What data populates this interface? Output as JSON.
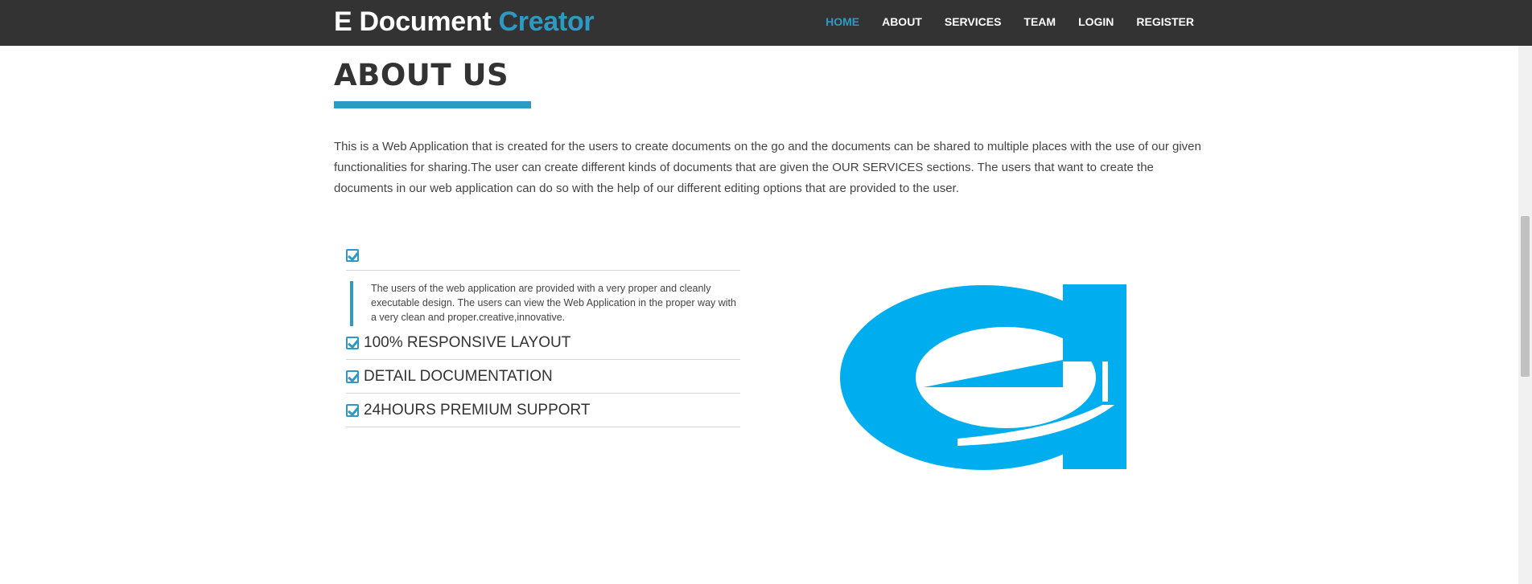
{
  "header": {
    "brand_main": "E Document ",
    "brand_accent": "Creator",
    "nav": [
      {
        "label": "HOME",
        "active": true
      },
      {
        "label": "ABOUT",
        "active": false
      },
      {
        "label": "SERVICES",
        "active": false
      },
      {
        "label": "TEAM",
        "active": false
      },
      {
        "label": "LOGIN",
        "active": false
      },
      {
        "label": "REGISTER",
        "active": false
      }
    ]
  },
  "about": {
    "title": "ABOUT US",
    "description": "This is a Web Application that is created for the users to create documents on the go and the documents can be shared to multiple places with the use of our given functionalities for sharing.The user can create different kinds of documents that are given the OUR SERVICES sections. The users that want to create the documents in our web application can do so with the help of our different editing options that are provided to the user."
  },
  "features": {
    "quote": "The users of the web application are provided with a very proper and cleanly executable design. The users can view the Web Application in the proper way with a very clean and proper.creative,innovative.",
    "items": [
      {
        "label": "100% RESPONSIVE LAYOUT"
      },
      {
        "label": "DETAIL DOCUMENTATION"
      },
      {
        "label": "24HOURS PREMIUM SUPPORT"
      }
    ]
  },
  "icons": {
    "check": "check-square-icon",
    "logo": "e-logo"
  },
  "colors": {
    "navbar_bg": "#333333",
    "accent": "#2e9ac4",
    "logo_blue": "#00adee"
  }
}
